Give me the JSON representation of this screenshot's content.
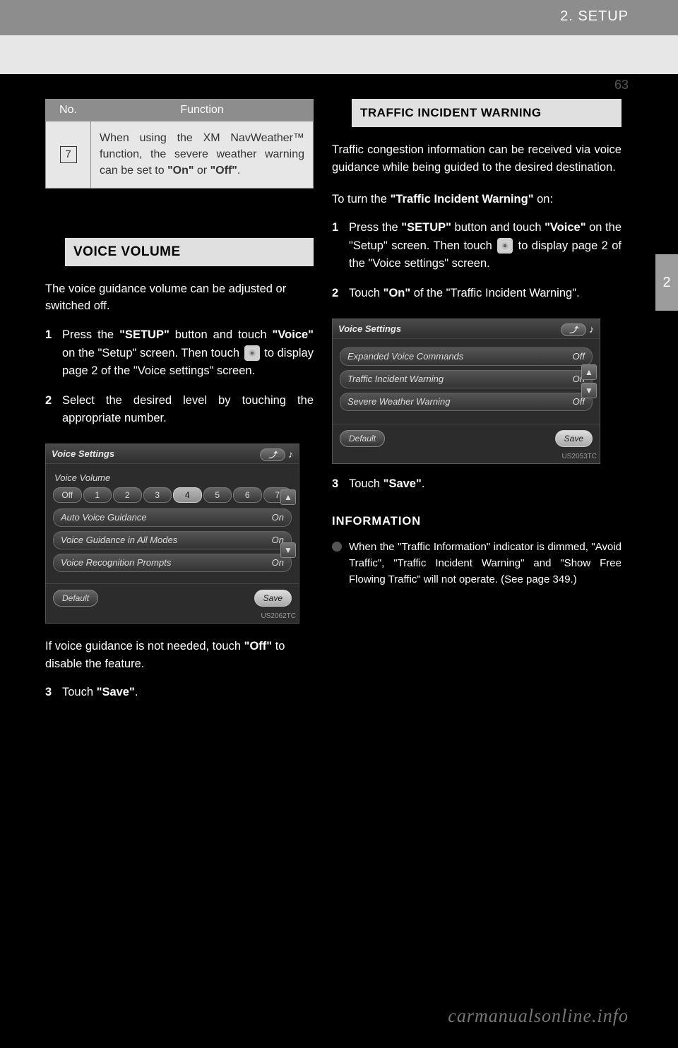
{
  "header": {
    "section": "2. SETUP",
    "page_number": "63"
  },
  "tab": {
    "label": "2"
  },
  "table": {
    "head_no": "No.",
    "head_fn": "Function",
    "row7_no": "7",
    "row7_fn_pre": "When using the XM NavWeather™ function, the severe weather warning can be set to ",
    "row7_fn_on": "\"On\"",
    "row7_fn_or": " or ",
    "row7_fn_off": "\"Off\"",
    "row7_fn_end": "."
  },
  "left": {
    "heading": "VOICE VOLUME",
    "intro": "The voice guidance volume can be adjusted or switched off.",
    "step1_num": "1",
    "step1a": "Press the ",
    "step1b": "\"SETUP\"",
    "step1c": " button and touch ",
    "step1d": "\"Voice\"",
    "step1e": " on the \"Setup\" screen. Then touch ",
    "step1f": " to display page 2 of the \"Voice settings\" screen.",
    "step2_num": "2",
    "step2": "Select the desired level by touching the appropriate number.",
    "after1": "If voice guidance is not needed, touch ",
    "after1b": "\"Off\"",
    "after1c": " to disable the feature.",
    "step3_num": "3",
    "step3a": "Touch ",
    "step3b": "\"Save\"",
    "step3c": "."
  },
  "right": {
    "heading": "TRAFFIC INCIDENT WARNING",
    "intro": "Traffic congestion information can be received via voice guidance while being guided to the desired destination.",
    "enable_pre": "To turn the ",
    "enable_b": "\"Traffic Incident Warning\"",
    "enable_on": " on:",
    "step1_num": "1",
    "step1a": "Press the ",
    "step1b": "\"SETUP\"",
    "step1c": " button and touch ",
    "step1d": "\"Voice\"",
    "step1e": " on the \"Setup\" screen. Then touch ",
    "step1f": " to display page 2 of the \"Voice settings\" screen.",
    "step2_num": "2",
    "step2a": "Touch ",
    "step2b": "\"On\"",
    "step2c": " of the \"Traffic Incident Warning\".",
    "step3_num": "3",
    "step3a": "Touch ",
    "step3b": "\"Save\"",
    "step3c": ".",
    "info_title": "INFORMATION",
    "info_bullet": "When the \"Traffic Information\" indicator is dimmed, \"Avoid Traffic\", \"Traffic Incident Warning\" and \"Show Free Flowing Traffic\" will not operate. (See page 349.)"
  },
  "shot_left": {
    "title": "Voice Settings",
    "label": "Voice Volume",
    "off": "Off",
    "vals": [
      "1",
      "2",
      "3",
      "4",
      "5",
      "6",
      "7"
    ],
    "rows": [
      {
        "name": "Auto Voice Guidance",
        "val": "On"
      },
      {
        "name": "Voice Guidance in All Modes",
        "val": "On"
      },
      {
        "name": "Voice Recognition Prompts",
        "val": "On"
      }
    ],
    "default": "Default",
    "save": "Save",
    "code": "US2062TC",
    "note": "♪"
  },
  "shot_right": {
    "title": "Voice Settings",
    "rows": [
      {
        "name": "Expanded Voice Commands",
        "val": "Off"
      },
      {
        "name": "Traffic Incident Warning",
        "val": "On"
      },
      {
        "name": "Severe Weather Warning",
        "val": "Off"
      }
    ],
    "default": "Default",
    "save": "Save",
    "code": "US2053TC",
    "note": "♪"
  },
  "watermark": "carmanualsonline.info"
}
